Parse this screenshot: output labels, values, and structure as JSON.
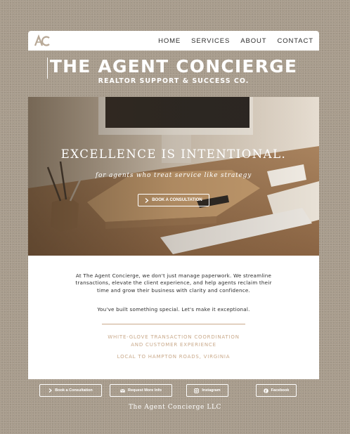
{
  "nav": {
    "logo_text": "AC",
    "links": [
      "HOME",
      "SERVICES",
      "ABOUT",
      "CONTACT"
    ]
  },
  "header": {
    "title": "THE AGENT CONCIERGE",
    "subtitle": "REALTOR SUPPORT & SUCCESS CO."
  },
  "hero": {
    "headline": "EXCELLENCE IS INTENTIONAL.",
    "tagline": "for agents who treat service like strategy",
    "cta_label": "BOOK A CONSULTATION",
    "cta_icon": "chevron-right-icon"
  },
  "content": {
    "intro": "At The Agent Concierge, we don't just manage paperwork. We streamline transactions, elevate the client experience, and help agents reclaim their time and grow their business with clarity and confidence.",
    "closing": "You've built something special. Let's make it exceptional.",
    "service_line_1": "WHITE-GLOVE TRANSACTION COORDINATION",
    "service_line_2": "AND CUSTOMER EXPERIENCE",
    "location": "LOCAL TO HAMPTON ROADS, VIRGINIA"
  },
  "footer": {
    "buttons": [
      {
        "label": "Book a Consultation",
        "icon": "chevron-right-icon"
      },
      {
        "label": "Request More Info",
        "icon": "email-icon"
      },
      {
        "label": "Instagram",
        "icon": "instagram-icon"
      },
      {
        "label": "Facebook",
        "icon": "facebook-icon"
      }
    ],
    "copyright": "The Agent Concierge LLC"
  },
  "colors": {
    "background": "#a89c8c",
    "accent": "#c9a98a",
    "panel": "#ffffff",
    "text": "#2c2c2c"
  }
}
